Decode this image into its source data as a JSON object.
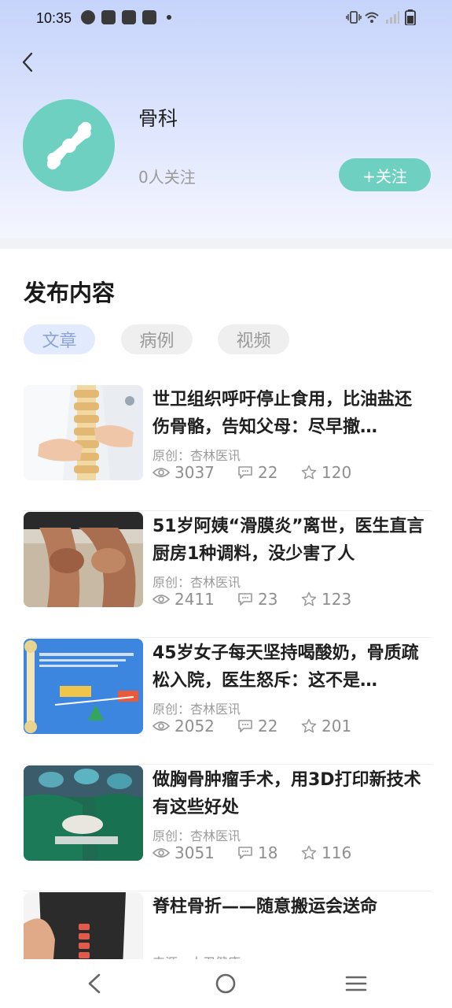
{
  "status_bar": {
    "time": "10:35",
    "left_icons": [
      "notification-app-icon",
      "mail-icon",
      "mail-icon",
      "mail-icon",
      "more-dot-icon"
    ],
    "right_icons": [
      "vibrate-icon",
      "wifi-icon",
      "signal-icon",
      "battery-icon"
    ]
  },
  "header": {
    "back_icon": "chevron-left-icon",
    "avatar_icon": "bone-joint-icon",
    "avatar_color": "#6ed0c0",
    "name": "骨科",
    "followers": "0人关注",
    "follow_label": "+关注"
  },
  "section": {
    "title": "发布内容",
    "tabs": [
      {
        "label": "文章",
        "active": true
      },
      {
        "label": "病例",
        "active": false
      },
      {
        "label": "视频",
        "active": false
      }
    ]
  },
  "articles": [
    {
      "title": "世卫组织呼吁停止食用，比油盐还伤骨骼，告知父母：尽早撤…",
      "source": "原创：杏林医讯",
      "views": "3037",
      "comments": "22",
      "favorites": "120",
      "thumb": "spine-model-photo"
    },
    {
      "title": "51岁阿姨“滑膜炎”离世，医生直言厨房1种调料，没少害了人",
      "source": "原创：杏林医讯",
      "views": "2411",
      "comments": "23",
      "favorites": "123",
      "thumb": "knee-pain-photo"
    },
    {
      "title": "45岁女子每天坚持喝酸奶，骨质疏松入院，医生怒斥：这不是…",
      "source": "原创：杏林医讯",
      "views": "2052",
      "comments": "22",
      "favorites": "201",
      "thumb": "osteoporosis-diagram"
    },
    {
      "title": "做胸骨肿瘤手术，用3D打印新技术有这些好处",
      "source": "原创：杏林医讯",
      "views": "3051",
      "comments": "18",
      "favorites": "116",
      "thumb": "surgery-photo"
    },
    {
      "title": "脊柱骨折——随意搬运会送命",
      "source": "来源：人卫健康",
      "views": "",
      "comments": "",
      "favorites": "",
      "thumb": "spine-back-photo"
    }
  ],
  "nav": {
    "back": "back-triangle-icon",
    "home": "home-circle-icon",
    "menu": "menu-lines-icon"
  }
}
